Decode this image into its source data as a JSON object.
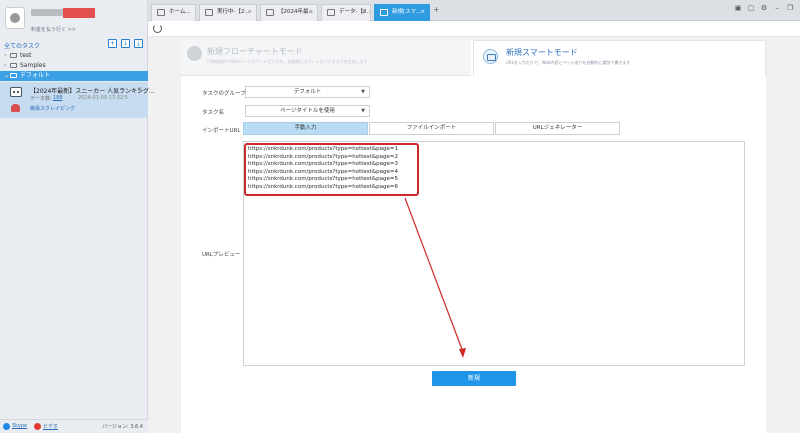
{
  "sidebar": {
    "user_link": "料金を払う行く >>",
    "all_tasks": "全てのタスク",
    "toolbar": [
      "+",
      "↓",
      "⤓"
    ],
    "tree": [
      {
        "label": "test",
        "expanded": false
      },
      {
        "label": "Samples",
        "expanded": false
      },
      {
        "label": "デフォルト",
        "expanded": true,
        "selected": true
      }
    ],
    "task": {
      "title": "【2024年最新】スニーカー 人気ランキング...",
      "close": "×",
      "count_label": "データ数:",
      "count": "188",
      "date": "2024-01-09 17:32:5",
      "mode": "簡易スクレイピング"
    },
    "footer": {
      "skype": "Skype",
      "video": "ビデオ",
      "version": "バージョン: 3.6.4"
    }
  },
  "tabs": [
    {
      "label": "ホーム...",
      "icon": "home-icon"
    },
    {
      "label": "実行中-【2...",
      "icon": "page-icon"
    },
    {
      "label": "【2024年最...",
      "icon": "page-icon"
    },
    {
      "label": "データ-【2...",
      "icon": "page-icon"
    },
    {
      "label": "新規[スマ...",
      "icon": "page-icon",
      "active": true
    }
  ],
  "tab_add": "+",
  "window_controls": [
    "▣",
    "▢",
    "⚙",
    "–",
    "❐"
  ],
  "modes": {
    "flow": {
      "title": "新規フローチャートモード",
      "desc": "可視化操作でWebページスクレイピングを、自動的にスクレイピングタスクを生成します"
    },
    "smart": {
      "title": "新規スマートモード",
      "desc": "URLを入力だけで、Web内容とページ送りを自動的に識別で書きます"
    }
  },
  "form": {
    "group_label": "タスクのグループ",
    "group_value": "デフォルト",
    "name_label": "タスク名",
    "name_value": "ページタイトルを使用",
    "import_label": "インポートURL",
    "import_tabs": [
      "手動入力",
      "ファイルインポート",
      "URLジェネレーター"
    ],
    "active_import_tab": 0,
    "preview_label": "URLプレビュー",
    "urls": [
      "https://snkrdunk.com/products?type=hottest&page=1",
      "https://snkrdunk.com/products?type=hottest&page=2",
      "https://snkrdunk.com/products?type=hottest&page=3",
      "https://snkrdunk.com/products?type=hottest&page=4",
      "https://snkrdunk.com/products?type=hottest&page=5",
      "https://snkrdunk.com/products?type=hottest&page=6"
    ],
    "create_button": "新規"
  },
  "colors": {
    "accent": "#2f9be0",
    "annotation": "#cc2a2a",
    "sidebar_selected": "#3ba0e6"
  }
}
